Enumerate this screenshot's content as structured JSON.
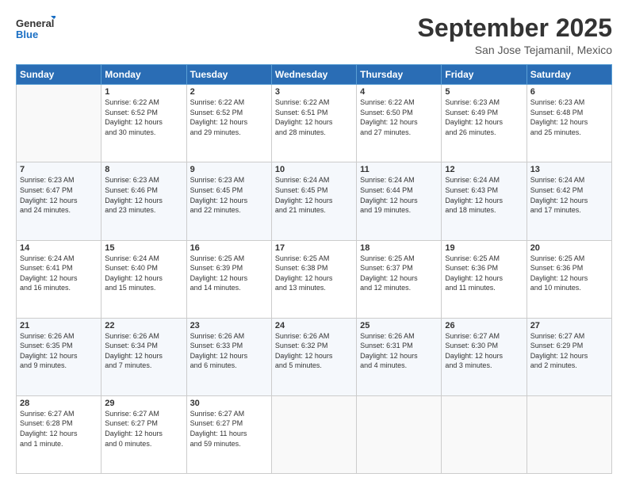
{
  "logo": {
    "line1": "General",
    "line2": "Blue"
  },
  "header": {
    "month": "September 2025",
    "location": "San Jose Tejamanil, Mexico"
  },
  "weekdays": [
    "Sunday",
    "Monday",
    "Tuesday",
    "Wednesday",
    "Thursday",
    "Friday",
    "Saturday"
  ],
  "weeks": [
    [
      {
        "day": "",
        "info": ""
      },
      {
        "day": "1",
        "info": "Sunrise: 6:22 AM\nSunset: 6:52 PM\nDaylight: 12 hours\nand 30 minutes."
      },
      {
        "day": "2",
        "info": "Sunrise: 6:22 AM\nSunset: 6:52 PM\nDaylight: 12 hours\nand 29 minutes."
      },
      {
        "day": "3",
        "info": "Sunrise: 6:22 AM\nSunset: 6:51 PM\nDaylight: 12 hours\nand 28 minutes."
      },
      {
        "day": "4",
        "info": "Sunrise: 6:22 AM\nSunset: 6:50 PM\nDaylight: 12 hours\nand 27 minutes."
      },
      {
        "day": "5",
        "info": "Sunrise: 6:23 AM\nSunset: 6:49 PM\nDaylight: 12 hours\nand 26 minutes."
      },
      {
        "day": "6",
        "info": "Sunrise: 6:23 AM\nSunset: 6:48 PM\nDaylight: 12 hours\nand 25 minutes."
      }
    ],
    [
      {
        "day": "7",
        "info": "Sunrise: 6:23 AM\nSunset: 6:47 PM\nDaylight: 12 hours\nand 24 minutes."
      },
      {
        "day": "8",
        "info": "Sunrise: 6:23 AM\nSunset: 6:46 PM\nDaylight: 12 hours\nand 23 minutes."
      },
      {
        "day": "9",
        "info": "Sunrise: 6:23 AM\nSunset: 6:45 PM\nDaylight: 12 hours\nand 22 minutes."
      },
      {
        "day": "10",
        "info": "Sunrise: 6:24 AM\nSunset: 6:45 PM\nDaylight: 12 hours\nand 21 minutes."
      },
      {
        "day": "11",
        "info": "Sunrise: 6:24 AM\nSunset: 6:44 PM\nDaylight: 12 hours\nand 19 minutes."
      },
      {
        "day": "12",
        "info": "Sunrise: 6:24 AM\nSunset: 6:43 PM\nDaylight: 12 hours\nand 18 minutes."
      },
      {
        "day": "13",
        "info": "Sunrise: 6:24 AM\nSunset: 6:42 PM\nDaylight: 12 hours\nand 17 minutes."
      }
    ],
    [
      {
        "day": "14",
        "info": "Sunrise: 6:24 AM\nSunset: 6:41 PM\nDaylight: 12 hours\nand 16 minutes."
      },
      {
        "day": "15",
        "info": "Sunrise: 6:24 AM\nSunset: 6:40 PM\nDaylight: 12 hours\nand 15 minutes."
      },
      {
        "day": "16",
        "info": "Sunrise: 6:25 AM\nSunset: 6:39 PM\nDaylight: 12 hours\nand 14 minutes."
      },
      {
        "day": "17",
        "info": "Sunrise: 6:25 AM\nSunset: 6:38 PM\nDaylight: 12 hours\nand 13 minutes."
      },
      {
        "day": "18",
        "info": "Sunrise: 6:25 AM\nSunset: 6:37 PM\nDaylight: 12 hours\nand 12 minutes."
      },
      {
        "day": "19",
        "info": "Sunrise: 6:25 AM\nSunset: 6:36 PM\nDaylight: 12 hours\nand 11 minutes."
      },
      {
        "day": "20",
        "info": "Sunrise: 6:25 AM\nSunset: 6:36 PM\nDaylight: 12 hours\nand 10 minutes."
      }
    ],
    [
      {
        "day": "21",
        "info": "Sunrise: 6:26 AM\nSunset: 6:35 PM\nDaylight: 12 hours\nand 9 minutes."
      },
      {
        "day": "22",
        "info": "Sunrise: 6:26 AM\nSunset: 6:34 PM\nDaylight: 12 hours\nand 7 minutes."
      },
      {
        "day": "23",
        "info": "Sunrise: 6:26 AM\nSunset: 6:33 PM\nDaylight: 12 hours\nand 6 minutes."
      },
      {
        "day": "24",
        "info": "Sunrise: 6:26 AM\nSunset: 6:32 PM\nDaylight: 12 hours\nand 5 minutes."
      },
      {
        "day": "25",
        "info": "Sunrise: 6:26 AM\nSunset: 6:31 PM\nDaylight: 12 hours\nand 4 minutes."
      },
      {
        "day": "26",
        "info": "Sunrise: 6:27 AM\nSunset: 6:30 PM\nDaylight: 12 hours\nand 3 minutes."
      },
      {
        "day": "27",
        "info": "Sunrise: 6:27 AM\nSunset: 6:29 PM\nDaylight: 12 hours\nand 2 minutes."
      }
    ],
    [
      {
        "day": "28",
        "info": "Sunrise: 6:27 AM\nSunset: 6:28 PM\nDaylight: 12 hours\nand 1 minute."
      },
      {
        "day": "29",
        "info": "Sunrise: 6:27 AM\nSunset: 6:27 PM\nDaylight: 12 hours\nand 0 minutes."
      },
      {
        "day": "30",
        "info": "Sunrise: 6:27 AM\nSunset: 6:27 PM\nDaylight: 11 hours\nand 59 minutes."
      },
      {
        "day": "",
        "info": ""
      },
      {
        "day": "",
        "info": ""
      },
      {
        "day": "",
        "info": ""
      },
      {
        "day": "",
        "info": ""
      }
    ]
  ]
}
